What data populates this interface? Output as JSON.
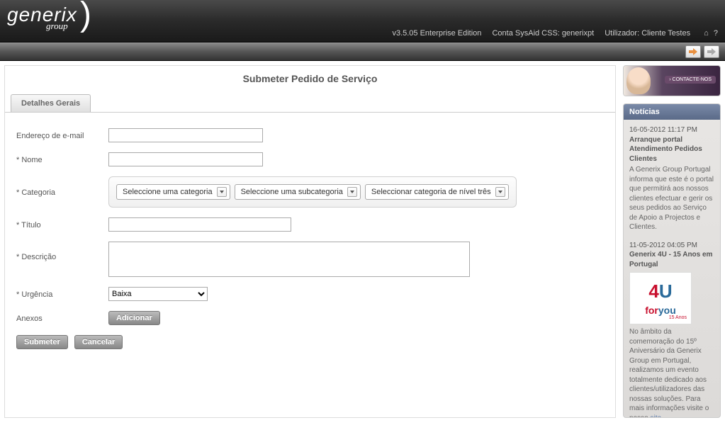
{
  "header": {
    "logo_main": "generix",
    "logo_sub": "group",
    "version": "v3.5.05 Enterprise Edition",
    "account_label": "Conta SysAid CSS: generixpt",
    "user_label": "Utilizador: Cliente Testes"
  },
  "page": {
    "title": "Submeter Pedido de Serviço",
    "tab_label": "Detalhes Gerais"
  },
  "form": {
    "email_label": "Endereço de e-mail",
    "name_label": "* Nome",
    "category_label": "* Categoria",
    "category_select_1": "Seleccione uma categoria",
    "category_select_2": "Seleccione uma subcategoria",
    "category_select_3": "Seleccionar categoria de nível três",
    "title_label": "* Título",
    "description_label": "* Descrição",
    "urgency_label": "* Urgência",
    "urgency_value": "Baixa",
    "attachments_label": "Anexos",
    "add_button": "Adicionar",
    "submit_button": "Submeter",
    "cancel_button": "Cancelar"
  },
  "sidebar": {
    "contact_button": "› CONTACTE-NOS",
    "news_header": "Notícias",
    "news": [
      {
        "date": "16-05-2012 11:17 PM",
        "title": "Arranque portal Atendimento Pedidos Clientes",
        "body": "A Generix Group Portugal informa que este é o portal que permitirá aos nossos clientes efectuar e gerir os seus pedidos ao Serviço de Apoio a Projectos e Clientes."
      },
      {
        "date": "11-05-2012 04:05 PM",
        "title": "Generix 4U - 15 Anos em Portugal",
        "body_prefix": "No âmbito da comemoração do 15º Aniversário da Generix Group em Portugal, realizamos um evento totalmente dedicado aos clientes/utilizadores das nossas soluções. Para mais informações visite o nosso ",
        "link_text": "site",
        "body_suffix": "."
      }
    ],
    "logo4u_sub": "15 Anos"
  }
}
